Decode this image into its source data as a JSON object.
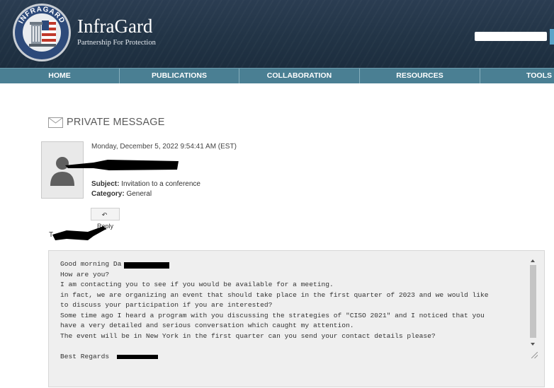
{
  "brand": {
    "name": "InfraGard",
    "tagline": "Partnership For Protection",
    "seal_text": "INFRAGARD"
  },
  "nav": {
    "items": [
      {
        "id": "home",
        "label": "HOME"
      },
      {
        "id": "publications",
        "label": "PUBLICATIONS"
      },
      {
        "id": "collaboration",
        "label": "COLLABORATION"
      },
      {
        "id": "resources",
        "label": "RESOURCES"
      },
      {
        "id": "tools",
        "label": "TOOLS"
      }
    ]
  },
  "message": {
    "section_title": "PRIVATE MESSAGE",
    "date": "Monday, December 5, 2022 9:54:41 AM (EST)",
    "subject_label": "Subject:",
    "subject": "Invitation to a conference",
    "category_label": "Category:",
    "category": "General",
    "reply_label": "Reply",
    "to_prefix": "T",
    "body_lines": [
      "Good morning Da",
      "How are you?",
      "I am contacting you to see if you would be available for a meeting.",
      "in fact, we are organizing an event that should take place in the first quarter of 2023 and we would like",
      "to discuss your participation if you are interested?",
      "Some time ago I heard a program with you discussing the strategies of \"CISO 2021\" and I noticed that you",
      "have a very detailed and serious conversation which caught my attention.",
      "The event will be in New York in the first quarter can you send your contact details please?",
      "",
      "Best Regards"
    ]
  },
  "colors": {
    "header_bg": "#223446",
    "nav_bg": "#4a7f93",
    "accent": "#5aa3c7",
    "body_bg": "#efefef"
  },
  "icons": {
    "section_icon": "envelope-icon",
    "reply_icon": "reply-arrow-icon",
    "avatar_icon": "user-silhouette-icon"
  }
}
